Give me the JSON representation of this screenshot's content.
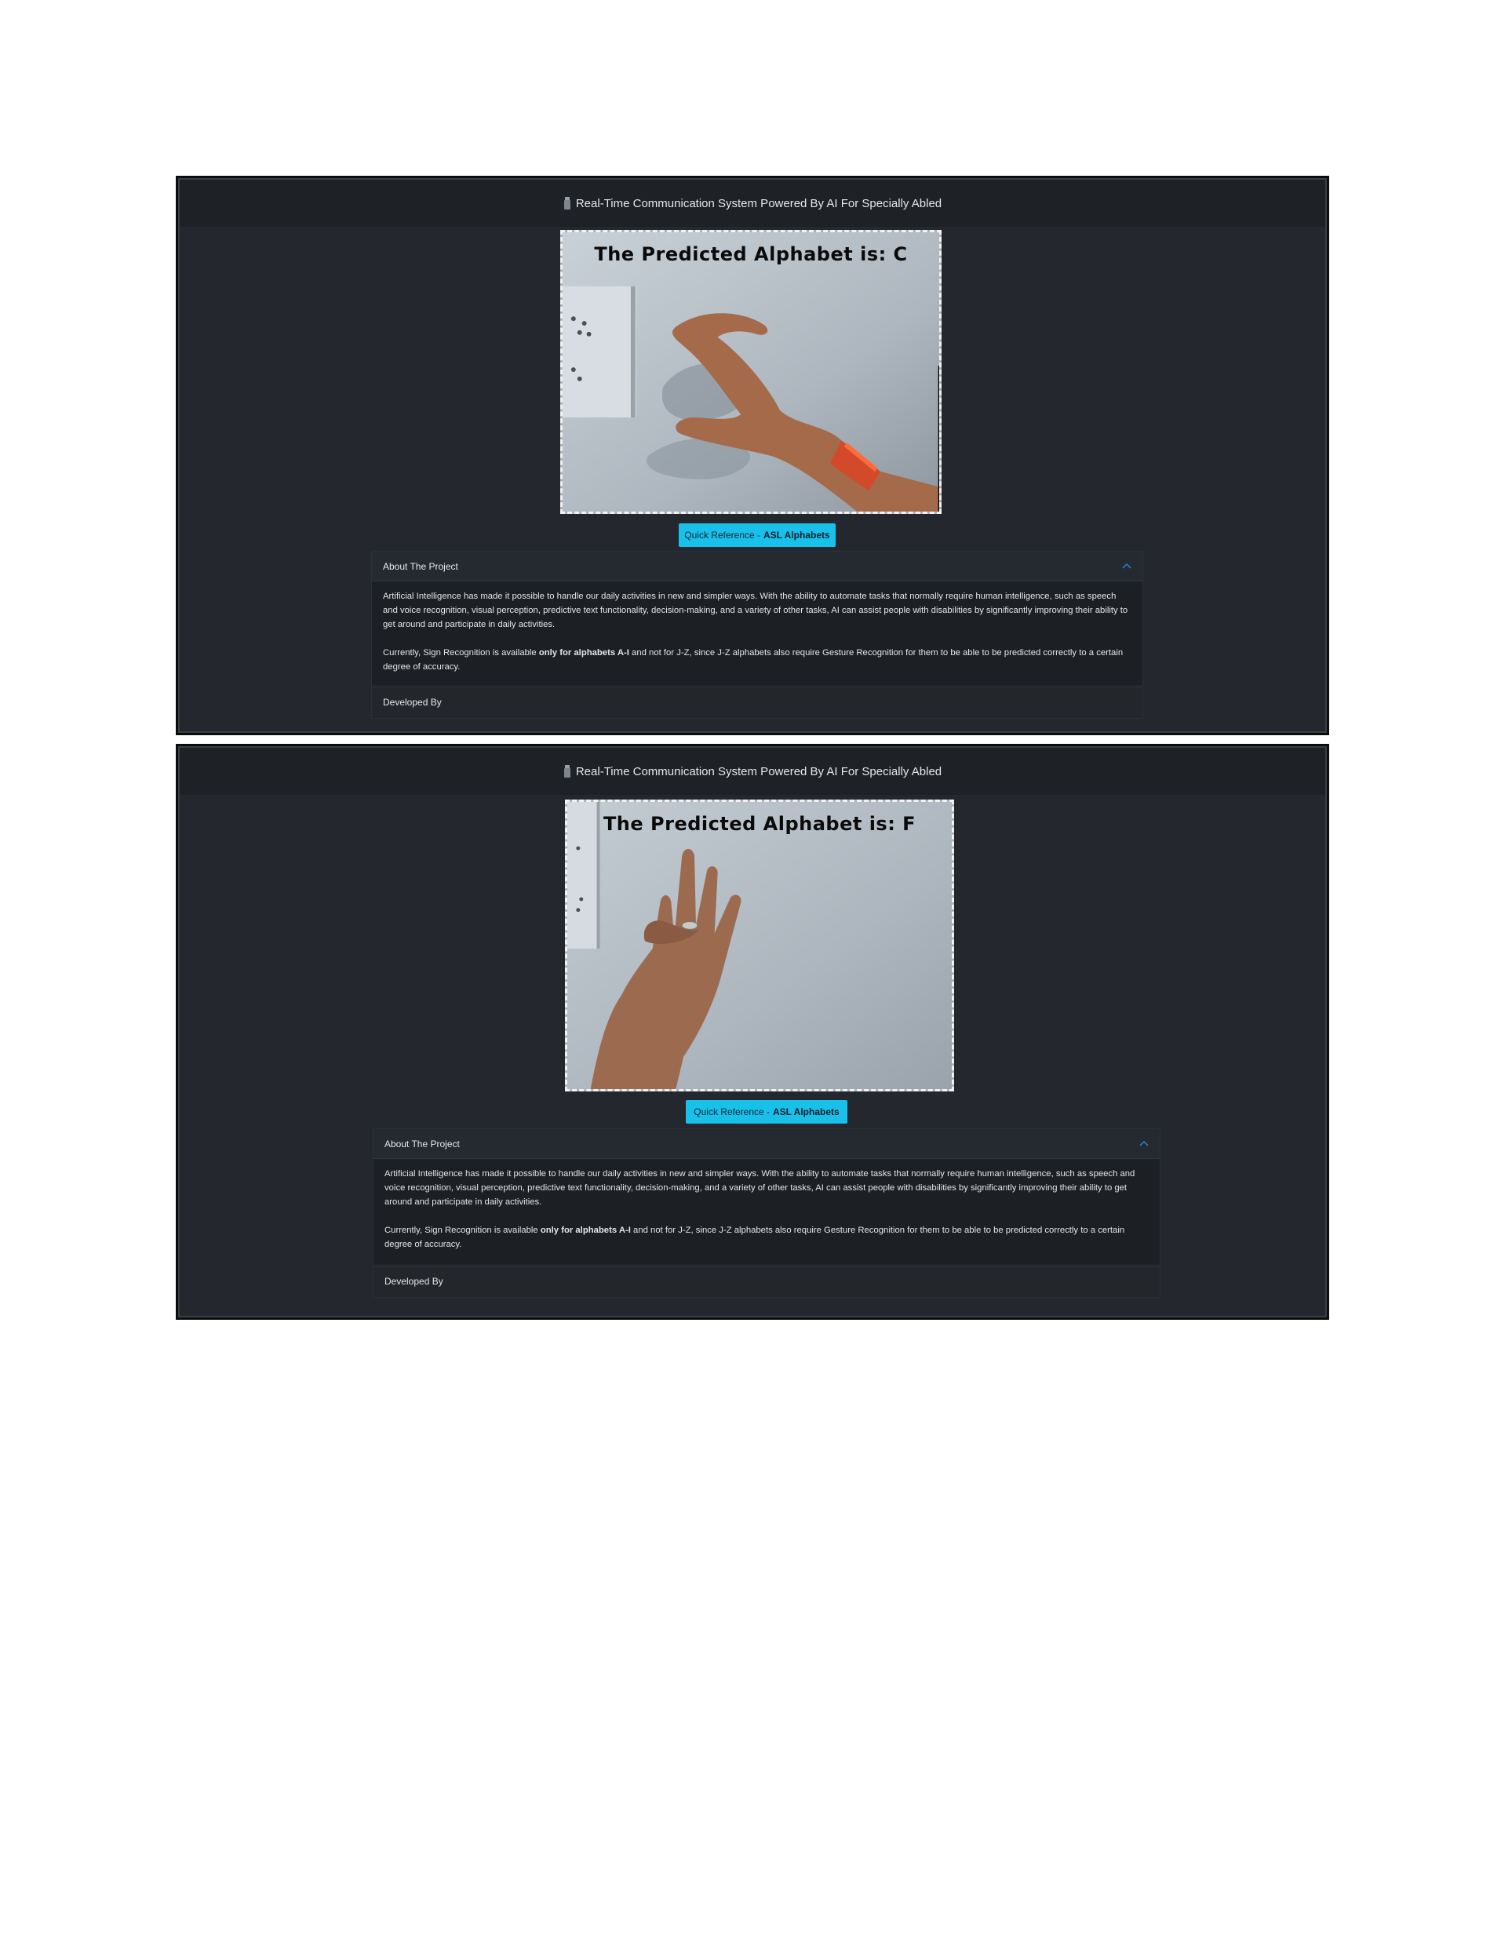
{
  "screens": [
    {
      "nav_title": "Real-Time Communication System Powered By AI For Specially Abled",
      "prediction_text": "The Predicted Alphabet is: C",
      "quick_ref": {
        "prefix": "Quick Reference - ",
        "bold": "ASL Alphabets"
      },
      "about": {
        "header": "About The Project",
        "p1": "Artificial Intelligence has made it possible to handle our daily activities in new and simpler ways. With the ability to automate tasks that normally require human intelligence, such as speech and voice recognition, visual perception, predictive text functionality, decision-making, and a variety of other tasks, AI can assist people with disabilities by significantly improving their ability to get around and participate in daily activities.",
        "p2_pre": "Currently, Sign Recognition is available ",
        "p2_bold": "only for alphabets A-I",
        "p2_post": " and not for J-Z, since J-Z alphabets also require Gesture Recognition for them to be able to be predicted correctly to a certain degree of accuracy."
      },
      "developed_by": "Developed By"
    },
    {
      "nav_title": "Real-Time Communication System Powered By AI For Specially Abled",
      "prediction_text": "The Predicted Alphabet is: F",
      "quick_ref": {
        "prefix": "Quick Reference - ",
        "bold": "ASL Alphabets"
      },
      "about": {
        "header": "About The Project",
        "p1": "Artificial Intelligence has made it possible to handle our daily activities in new and simpler ways. With the ability to automate tasks that normally require human intelligence, such as speech and voice recognition, visual perception, predictive text functionality, decision-making, and a variety of other tasks, AI can assist people with disabilities by significantly improving their ability to get around and participate in daily activities.",
        "p2_pre": "Currently, Sign Recognition is available ",
        "p2_bold": "only for alphabets A-I",
        "p2_post": " and not for J-Z, since J-Z alphabets also require Gesture Recognition for them to be able to be predicted correctly to a certain degree of accuracy."
      },
      "developed_by": "Developed By"
    }
  ],
  "colors": {
    "background": "#24282e",
    "navbar": "#1e2227",
    "accent_button": "#19c0ea",
    "frame_border": "#0c0c0c"
  }
}
